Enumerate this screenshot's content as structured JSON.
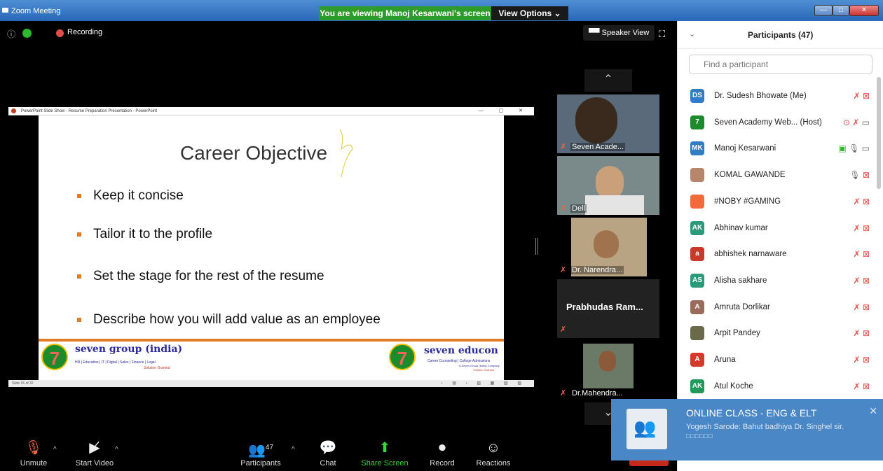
{
  "window": {
    "title": "Zoom Meeting",
    "banner": "You are viewing Manoj Kesarwani's screen",
    "view_options": "View Options ⌄"
  },
  "meeting": {
    "recording": "Recording",
    "speaker_view": "Speaker View"
  },
  "slide": {
    "ppt_title": "PowerPoint Slide Show - Resume Preparation Presentation - PowerPoint",
    "heading": "Career Objective",
    "bullets": [
      "Keep it concise",
      "Tailor it to the profile",
      "Set the stage for the rest of the resume",
      "Describe how you will add value as an employee"
    ],
    "left_logo": {
      "num": "7",
      "name": "seven group (india)",
      "sub": "HR | Education | IT | Digital | Sales | Finance | Legal",
      "tag": "Solution Granted"
    },
    "right_logo": {
      "num": "7",
      "name": "seven educon",
      "sub": "Career Counseling | College Admissions",
      "sub2": "A Seven Group (India) Company",
      "tag": "Solution Granted"
    },
    "status": "Slide 15 of 32"
  },
  "thumbs": [
    {
      "name": "Seven Acade..."
    },
    {
      "name": "Dell"
    },
    {
      "name": "Dr. Narendra..."
    },
    {
      "name": "Prabhudas Ram..."
    },
    {
      "name": "Dr.Mahendra..."
    }
  ],
  "toolbar": {
    "unmute": "Unmute",
    "start_video": "Start Video",
    "participants": "Participants",
    "participants_count": "47",
    "chat": "Chat",
    "share": "Share Screen",
    "record": "Record",
    "reactions": "Reactions"
  },
  "panel": {
    "title": "Participants (47)",
    "search_placeholder": "Find a participant",
    "participants": [
      {
        "initials": "DS",
        "name": "Dr. Sudesh Bhowate (Me)",
        "color": "#2f7dc4"
      },
      {
        "initials": "7",
        "name": "Seven Academy Web... (Host)",
        "color": "#1c8b2c"
      },
      {
        "initials": "MK",
        "name": "Manoj Kesarwani",
        "color": "#2f7dc4"
      },
      {
        "initials": "",
        "name": "KOMAL GAWANDE",
        "color": "#b8866a"
      },
      {
        "initials": "",
        "name": "#NOBY #GAMING",
        "color": "#f06a3a"
      },
      {
        "initials": "AK",
        "name": "Abhinav kumar",
        "color": "#2a9b7a"
      },
      {
        "initials": "a",
        "name": "abhishek narnaware",
        "color": "#c83a2a"
      },
      {
        "initials": "AS",
        "name": "Alisha sakhare",
        "color": "#2a9b7a"
      },
      {
        "initials": "A",
        "name": "Amruta Dorlikar",
        "color": "#9a6a5a"
      },
      {
        "initials": "",
        "name": "Arpit Pandey",
        "color": "#6a6a4a"
      },
      {
        "initials": "A",
        "name": "Aruna",
        "color": "#d43a2a"
      },
      {
        "initials": "AK",
        "name": "Atul Koche",
        "color": "#1f9a5a"
      }
    ]
  },
  "notification": {
    "title": "ONLINE CLASS - ENG & ELT",
    "message": "Yogesh Sarode: Bahut badhiya Dr. Singhel sir.",
    "extra": "□□□□□□"
  }
}
